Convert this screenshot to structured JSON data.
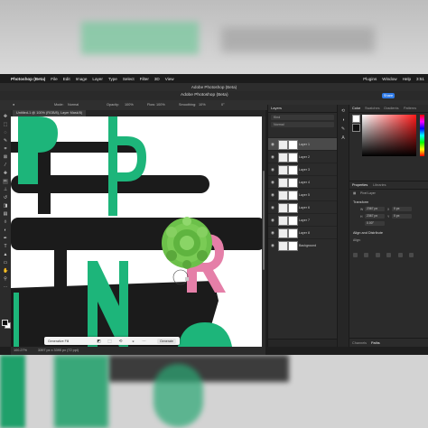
{
  "mac_menu": {
    "apple_icon": "apple-icon",
    "app_name": "Photoshop (Beta)",
    "items": [
      "File",
      "Edit",
      "Image",
      "Layer",
      "Type",
      "Select",
      "Filter",
      "3D",
      "View"
    ],
    "right_items": [
      "Plugins",
      "Window",
      "Help"
    ],
    "clock": "3:51"
  },
  "window_title": "Adobe Photoshop (Beta)",
  "app_bar": {
    "title": "Adobe Photoshop (Beta)",
    "share_label": "Share"
  },
  "options_bar": {
    "mode_label": "Mode:",
    "mode_value": "Normal",
    "opacity_label": "Opacity:",
    "opacity_value": "100%",
    "flow_label": "Flow:",
    "flow_value": "100%",
    "smoothing_label": "Smoothing:",
    "smoothing_value": "10%",
    "angle_value": "0°"
  },
  "document_tab": {
    "label": "Untitled-1 @ 100% (RGB/8), Layer Mask/8)"
  },
  "canvas": {
    "letters": [
      "P",
      "R",
      "N"
    ],
    "colors": {
      "green": "#1db57a",
      "pink": "#e57fa8",
      "black": "#1b1b1b",
      "flower": "#6cc04a"
    }
  },
  "contextual_task_bar": {
    "prompt_label": "Generative Fill",
    "generate_label": "Generate"
  },
  "status_bar": {
    "zoom": "100.27%",
    "doc_size": "3397 px x 3395 px (72 ppi)"
  },
  "layers_panel": {
    "title": "Layers",
    "kind_filter": "Kind",
    "blend_mode": "Normal",
    "opacity_label": "Opacity:",
    "opacity_value": "100%",
    "fill_label": "Fill:",
    "fill_value": "100%",
    "layers": [
      {
        "name": "Layer 1",
        "selected": true
      },
      {
        "name": "Layer 2",
        "selected": false
      },
      {
        "name": "Layer 3",
        "selected": false
      },
      {
        "name": "Layer 4",
        "selected": false
      },
      {
        "name": "Layer 5",
        "selected": false
      },
      {
        "name": "Layer 6",
        "selected": false
      },
      {
        "name": "Layer 7",
        "selected": false
      },
      {
        "name": "Layer 8",
        "selected": false
      },
      {
        "name": "Background",
        "selected": false
      }
    ]
  },
  "color_panel": {
    "tabs": [
      "Color",
      "Swatches",
      "Gradients",
      "Patterns"
    ],
    "active_tab": "Color",
    "hue": "#ff1a1a"
  },
  "properties_panel": {
    "tabs": [
      "Properties",
      "Libraries"
    ],
    "pixel_layer_label": "Pixel Layer",
    "transform_label": "Transform",
    "w_label": "W",
    "w_value": "2367 px",
    "h_label": "H",
    "h_value": "2367 px",
    "x_label": "X",
    "x_value": "0 px",
    "y_label": "Y",
    "y_value": "0 px",
    "angle_value": "0.00°",
    "align_label": "Align and Distribute",
    "align_sub": "Align:"
  },
  "bottom_tabs": {
    "tabs": [
      "Channels",
      "Paths"
    ],
    "active_tab": "Paths"
  }
}
